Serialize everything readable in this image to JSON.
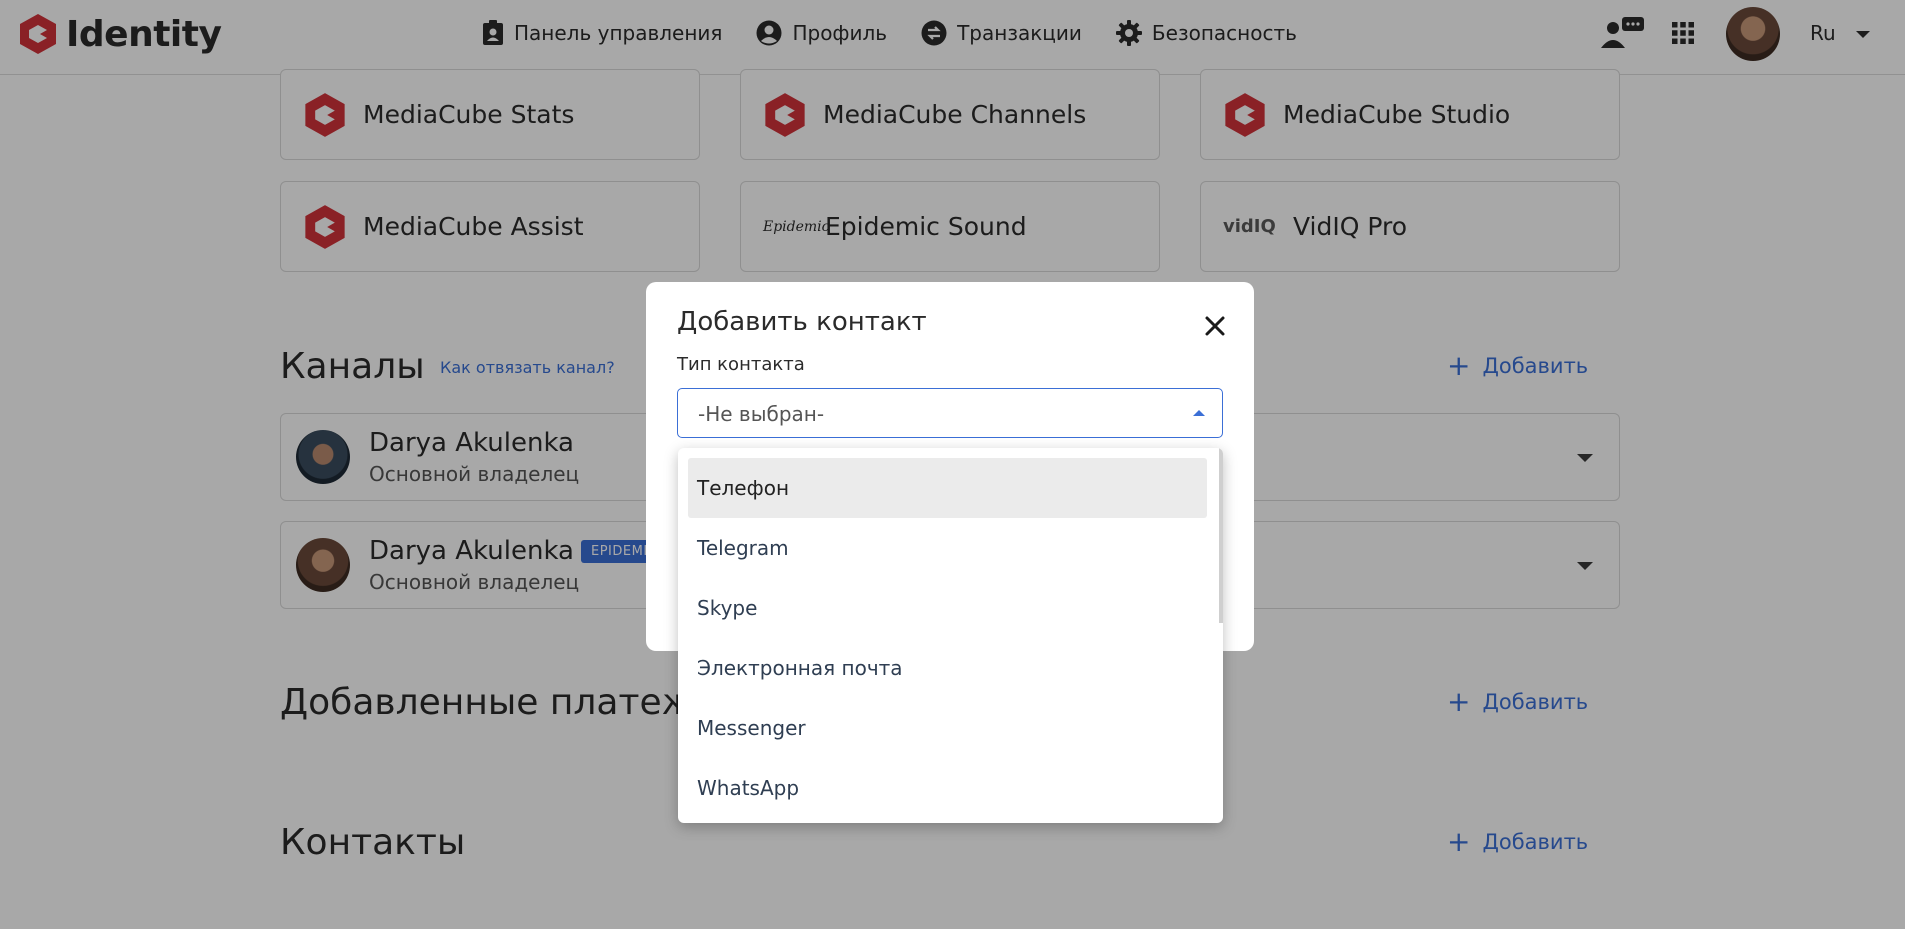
{
  "header": {
    "logo_text": "Identity",
    "nav": [
      {
        "label": "Панель управления",
        "icon": "id-badge-icon"
      },
      {
        "label": "Профиль",
        "icon": "user-circle-icon"
      },
      {
        "label": "Транзакции",
        "icon": "exchange-icon"
      },
      {
        "label": "Безопасность",
        "icon": "gear-icon"
      }
    ],
    "language": "Ru"
  },
  "services": [
    {
      "name": "MediaCube Stats",
      "icon": "mediacube-logo-icon"
    },
    {
      "name": "MediaCube Channels",
      "icon": "mediacube-logo-icon"
    },
    {
      "name": "MediaCube Studio",
      "icon": "mediacube-logo-icon"
    },
    {
      "name": "MediaCube Assist",
      "icon": "mediacube-logo-icon"
    },
    {
      "name": "Epidemic Sound",
      "icon": "epidemic-logo-icon"
    },
    {
      "name": "VidIQ Pro",
      "icon": "vidiq-logo-icon"
    }
  ],
  "logo_marks": {
    "epidemic": "Epidemic",
    "vidiq": "vidIQ"
  },
  "channels_section": {
    "title": "Каналы",
    "help_link": "Как отвязать канал?",
    "add_label": "Добавить",
    "items": [
      {
        "name": "Darya Akulenka",
        "role": "Основной владелец",
        "badge": ""
      },
      {
        "name": "Darya Akulenka",
        "role": "Основной владелец",
        "badge": "EPIDEMI"
      }
    ]
  },
  "payments_section": {
    "title": "Добавленные платеж",
    "add_label": "Добавить"
  },
  "contacts_section": {
    "title": "Контакты",
    "add_label": "Добавить"
  },
  "modal": {
    "title": "Добавить контакт",
    "field_label": "Тип контакта",
    "select_value": "-Не выбран-",
    "options": [
      "Телефон",
      "Telegram",
      "Skype",
      "Электронная почта",
      "Messenger",
      "WhatsApp"
    ],
    "highlighted_option": "Телефон"
  },
  "colors": {
    "brand": "#d2323a",
    "accent": "#3b6fd6",
    "text": "#2b2b2b"
  }
}
